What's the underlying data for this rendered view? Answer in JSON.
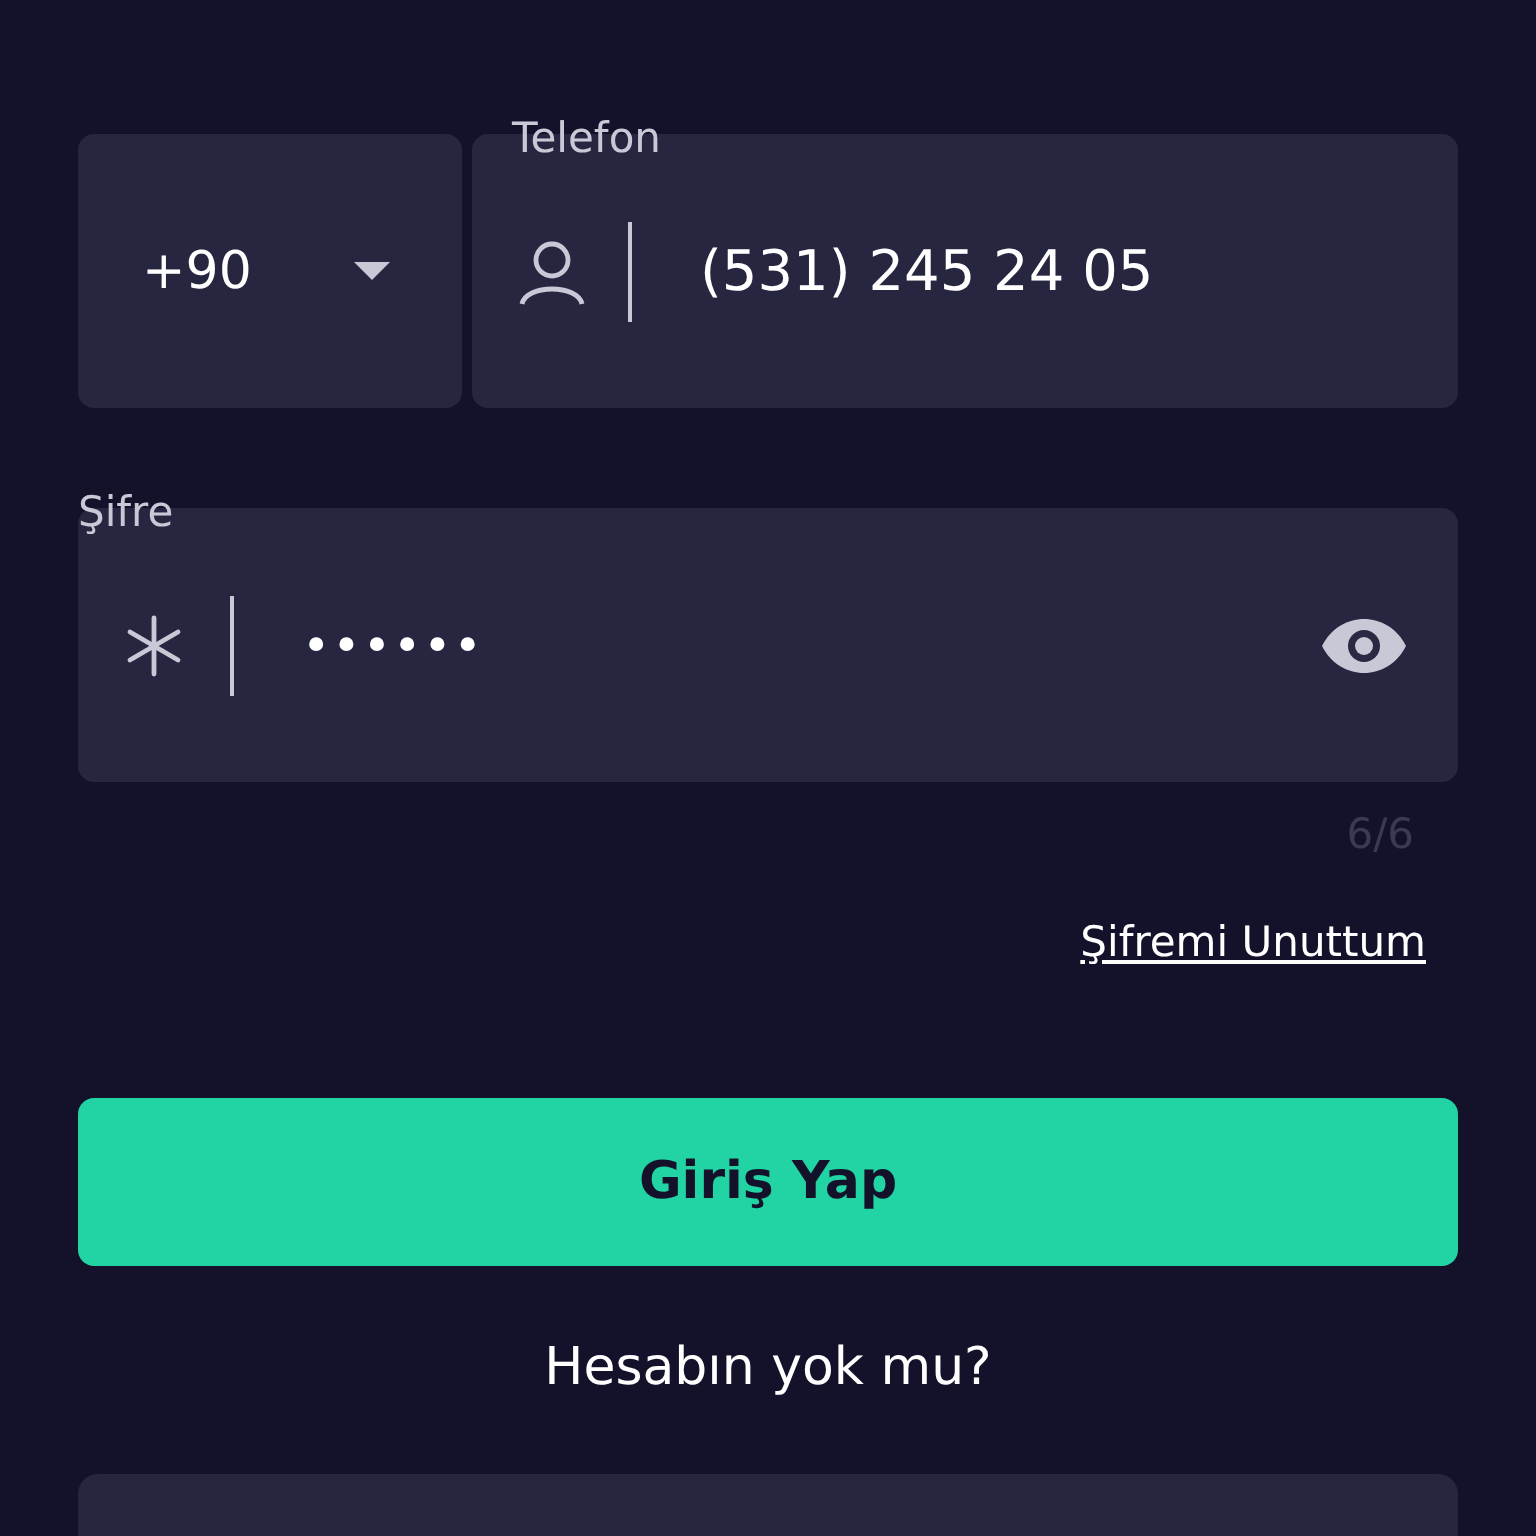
{
  "phone": {
    "country_code": "+90",
    "label": "Telefon",
    "value": "(531) 245 24 05"
  },
  "password": {
    "label": "Şifre",
    "value": "••••••",
    "counter": "6/6"
  },
  "forgot_link": "Şifremi Unuttum",
  "login_button": "Giriş Yap",
  "signup_prompt": "Hesabın yok mu?"
}
